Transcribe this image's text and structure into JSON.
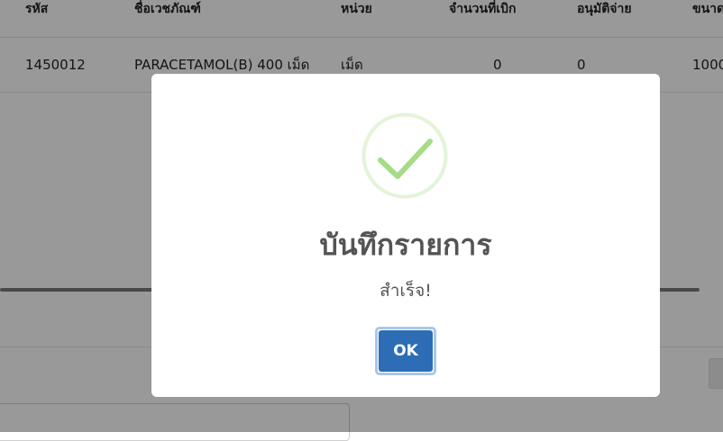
{
  "table": {
    "headers": [
      "รหัส",
      "ชื่อเวชภัณฑ์",
      "หน่วย",
      "จำนวนที่เบิก",
      "อนุมัติจ่าย",
      "ขนาด"
    ],
    "rows": [
      {
        "code": "1450012",
        "name": "PARACETAMOL(B) 400 เม็ด",
        "unit": "เม็ด",
        "requested": "0",
        "approved": "0",
        "size": "1000"
      }
    ]
  },
  "dialog": {
    "icon": "success-check-icon",
    "title": "บันทึกรายการ",
    "text": "สำเร็จ!",
    "ok_label": "OK"
  },
  "colors": {
    "check_green": "#a5dc86",
    "check_ring": "#e3f4d8",
    "ok_button": "#2d6db5",
    "overlay": "rgba(0,0,0,0.40)"
  }
}
